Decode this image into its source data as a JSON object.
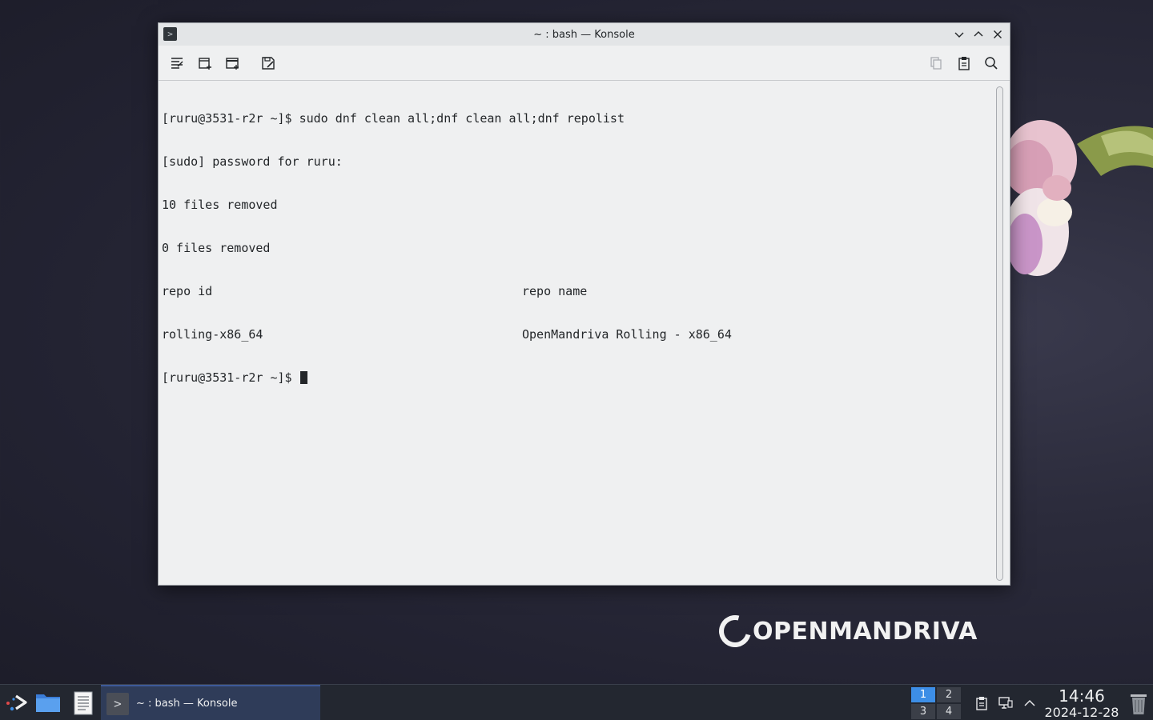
{
  "window": {
    "title": "~ : bash — Konsole",
    "buttons": [
      "minimize",
      "maximize",
      "close"
    ]
  },
  "toolbar": {
    "left_icons": [
      "clear-scrollback-icon",
      "new-tab-icon",
      "new-window-icon",
      "save-output-icon"
    ],
    "right_icons": [
      "copy-icon",
      "paste-icon",
      "find-icon"
    ]
  },
  "terminal": {
    "lines": [
      "[ruru@3531-r2r ~]$ sudo dnf clean all;dnf clean all;dnf repolist",
      "[sudo] password for ruru:",
      "10 files removed",
      "0 files removed"
    ],
    "table": {
      "header": [
        "repo id",
        "repo name"
      ],
      "row": [
        "rolling-x86_64",
        "OpenMandriva Rolling - x86_64"
      ]
    },
    "prompt": "[ruru@3531-r2r ~]$ "
  },
  "desktop": {
    "logo_text": "OPENMANDRIVA"
  },
  "taskbar": {
    "task_label": "~ : bash — Konsole",
    "pager": [
      "1",
      "2",
      "3",
      "4"
    ],
    "active_desktop": "1",
    "clock_time": "14:46",
    "clock_date": "2024-12-28"
  },
  "colors": {
    "accent": "#3d8ee6",
    "terminal_bg": "#eff0f1",
    "terminal_fg": "#232629",
    "taskbar_bg": "#232730"
  }
}
